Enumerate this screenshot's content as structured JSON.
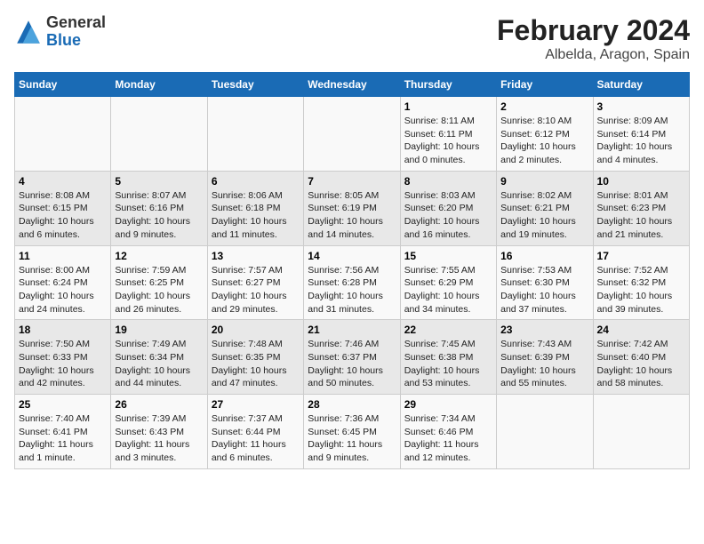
{
  "header": {
    "logo_general": "General",
    "logo_blue": "Blue",
    "month_year": "February 2024",
    "location": "Albelda, Aragon, Spain"
  },
  "days_of_week": [
    "Sunday",
    "Monday",
    "Tuesday",
    "Wednesday",
    "Thursday",
    "Friday",
    "Saturday"
  ],
  "weeks": [
    [
      {
        "day": "",
        "info": ""
      },
      {
        "day": "",
        "info": ""
      },
      {
        "day": "",
        "info": ""
      },
      {
        "day": "",
        "info": ""
      },
      {
        "day": "1",
        "info": "Sunrise: 8:11 AM\nSunset: 6:11 PM\nDaylight: 10 hours and 0 minutes."
      },
      {
        "day": "2",
        "info": "Sunrise: 8:10 AM\nSunset: 6:12 PM\nDaylight: 10 hours and 2 minutes."
      },
      {
        "day": "3",
        "info": "Sunrise: 8:09 AM\nSunset: 6:14 PM\nDaylight: 10 hours and 4 minutes."
      }
    ],
    [
      {
        "day": "4",
        "info": "Sunrise: 8:08 AM\nSunset: 6:15 PM\nDaylight: 10 hours and 6 minutes."
      },
      {
        "day": "5",
        "info": "Sunrise: 8:07 AM\nSunset: 6:16 PM\nDaylight: 10 hours and 9 minutes."
      },
      {
        "day": "6",
        "info": "Sunrise: 8:06 AM\nSunset: 6:18 PM\nDaylight: 10 hours and 11 minutes."
      },
      {
        "day": "7",
        "info": "Sunrise: 8:05 AM\nSunset: 6:19 PM\nDaylight: 10 hours and 14 minutes."
      },
      {
        "day": "8",
        "info": "Sunrise: 8:03 AM\nSunset: 6:20 PM\nDaylight: 10 hours and 16 minutes."
      },
      {
        "day": "9",
        "info": "Sunrise: 8:02 AM\nSunset: 6:21 PM\nDaylight: 10 hours and 19 minutes."
      },
      {
        "day": "10",
        "info": "Sunrise: 8:01 AM\nSunset: 6:23 PM\nDaylight: 10 hours and 21 minutes."
      }
    ],
    [
      {
        "day": "11",
        "info": "Sunrise: 8:00 AM\nSunset: 6:24 PM\nDaylight: 10 hours and 24 minutes."
      },
      {
        "day": "12",
        "info": "Sunrise: 7:59 AM\nSunset: 6:25 PM\nDaylight: 10 hours and 26 minutes."
      },
      {
        "day": "13",
        "info": "Sunrise: 7:57 AM\nSunset: 6:27 PM\nDaylight: 10 hours and 29 minutes."
      },
      {
        "day": "14",
        "info": "Sunrise: 7:56 AM\nSunset: 6:28 PM\nDaylight: 10 hours and 31 minutes."
      },
      {
        "day": "15",
        "info": "Sunrise: 7:55 AM\nSunset: 6:29 PM\nDaylight: 10 hours and 34 minutes."
      },
      {
        "day": "16",
        "info": "Sunrise: 7:53 AM\nSunset: 6:30 PM\nDaylight: 10 hours and 37 minutes."
      },
      {
        "day": "17",
        "info": "Sunrise: 7:52 AM\nSunset: 6:32 PM\nDaylight: 10 hours and 39 minutes."
      }
    ],
    [
      {
        "day": "18",
        "info": "Sunrise: 7:50 AM\nSunset: 6:33 PM\nDaylight: 10 hours and 42 minutes."
      },
      {
        "day": "19",
        "info": "Sunrise: 7:49 AM\nSunset: 6:34 PM\nDaylight: 10 hours and 44 minutes."
      },
      {
        "day": "20",
        "info": "Sunrise: 7:48 AM\nSunset: 6:35 PM\nDaylight: 10 hours and 47 minutes."
      },
      {
        "day": "21",
        "info": "Sunrise: 7:46 AM\nSunset: 6:37 PM\nDaylight: 10 hours and 50 minutes."
      },
      {
        "day": "22",
        "info": "Sunrise: 7:45 AM\nSunset: 6:38 PM\nDaylight: 10 hours and 53 minutes."
      },
      {
        "day": "23",
        "info": "Sunrise: 7:43 AM\nSunset: 6:39 PM\nDaylight: 10 hours and 55 minutes."
      },
      {
        "day": "24",
        "info": "Sunrise: 7:42 AM\nSunset: 6:40 PM\nDaylight: 10 hours and 58 minutes."
      }
    ],
    [
      {
        "day": "25",
        "info": "Sunrise: 7:40 AM\nSunset: 6:41 PM\nDaylight: 11 hours and 1 minute."
      },
      {
        "day": "26",
        "info": "Sunrise: 7:39 AM\nSunset: 6:43 PM\nDaylight: 11 hours and 3 minutes."
      },
      {
        "day": "27",
        "info": "Sunrise: 7:37 AM\nSunset: 6:44 PM\nDaylight: 11 hours and 6 minutes."
      },
      {
        "day": "28",
        "info": "Sunrise: 7:36 AM\nSunset: 6:45 PM\nDaylight: 11 hours and 9 minutes."
      },
      {
        "day": "29",
        "info": "Sunrise: 7:34 AM\nSunset: 6:46 PM\nDaylight: 11 hours and 12 minutes."
      },
      {
        "day": "",
        "info": ""
      },
      {
        "day": "",
        "info": ""
      }
    ]
  ]
}
